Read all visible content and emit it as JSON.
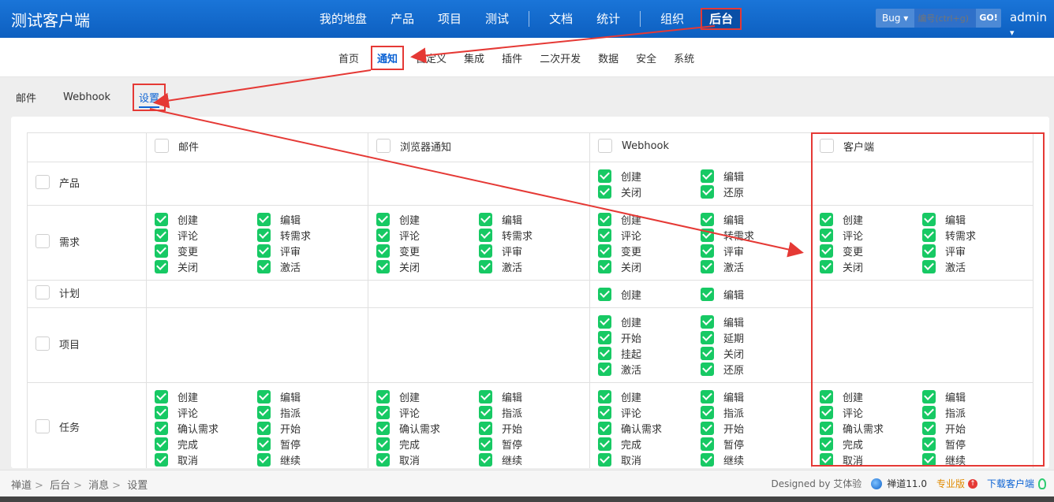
{
  "header": {
    "brand": "测试客户端",
    "nav": [
      {
        "label": "我的地盘"
      },
      {
        "label": "产品"
      },
      {
        "label": "项目"
      },
      {
        "label": "测试"
      },
      {
        "label": "文档"
      },
      {
        "label": "统计"
      },
      {
        "label": "组织"
      },
      {
        "label": "后台"
      }
    ],
    "quick_type": "Bug",
    "search_placeholder": "编号(ctrl+g)",
    "go_label": "GO!",
    "user": "admin"
  },
  "subnav": [
    "首页",
    "通知",
    "自定义",
    "集成",
    "插件",
    "二次开发",
    "数据",
    "安全",
    "系统"
  ],
  "tabs": [
    "邮件",
    "Webhook",
    "设置"
  ],
  "grid": {
    "columns": [
      "邮件",
      "浏览器通知",
      "Webhook",
      "客户端"
    ],
    "rows": [
      {
        "name": "产品",
        "cells": [
          [],
          [],
          [
            "创建",
            "编辑",
            "关闭",
            "还原"
          ],
          []
        ]
      },
      {
        "name": "需求",
        "cells": [
          [
            "创建",
            "编辑",
            "评论",
            "转需求",
            "变更",
            "评审",
            "关闭",
            "激活"
          ],
          [
            "创建",
            "编辑",
            "评论",
            "转需求",
            "变更",
            "评审",
            "关闭",
            "激活"
          ],
          [
            "创建",
            "编辑",
            "评论",
            "转需求",
            "变更",
            "评审",
            "关闭",
            "激活"
          ],
          [
            "创建",
            "编辑",
            "评论",
            "转需求",
            "变更",
            "评审",
            "关闭",
            "激活"
          ]
        ]
      },
      {
        "name": "计划",
        "cells": [
          [],
          [],
          [
            "创建",
            "编辑"
          ],
          []
        ]
      },
      {
        "name": "项目",
        "cells": [
          [],
          [],
          [
            "创建",
            "编辑",
            "开始",
            "延期",
            "挂起",
            "关闭",
            "激活",
            "还原"
          ],
          []
        ]
      },
      {
        "name": "任务",
        "cells": [
          [
            "创建",
            "编辑",
            "评论",
            "指派",
            "确认需求",
            "开始",
            "完成",
            "暂停",
            "取消",
            "继续"
          ],
          [
            "创建",
            "编辑",
            "评论",
            "指派",
            "确认需求",
            "开始",
            "完成",
            "暂停",
            "取消",
            "继续"
          ],
          [
            "创建",
            "编辑",
            "评论",
            "指派",
            "确认需求",
            "开始",
            "完成",
            "暂停",
            "取消",
            "继续"
          ],
          [
            "创建",
            "编辑",
            "评论",
            "指派",
            "确认需求",
            "开始",
            "完成",
            "暂停",
            "取消",
            "继续"
          ]
        ]
      }
    ]
  },
  "footer": {
    "breadcrumbs": [
      "禅道",
      "后台",
      "消息",
      "设置"
    ],
    "designed_by": "Designed by 艾体验",
    "version": "禅道11.0",
    "edition": "专业版",
    "download": "下载客户端"
  },
  "colors": {
    "header": "#1a75d8",
    "accent": "#0c63d4",
    "check": "#17c964",
    "annotation": "#e53935"
  }
}
